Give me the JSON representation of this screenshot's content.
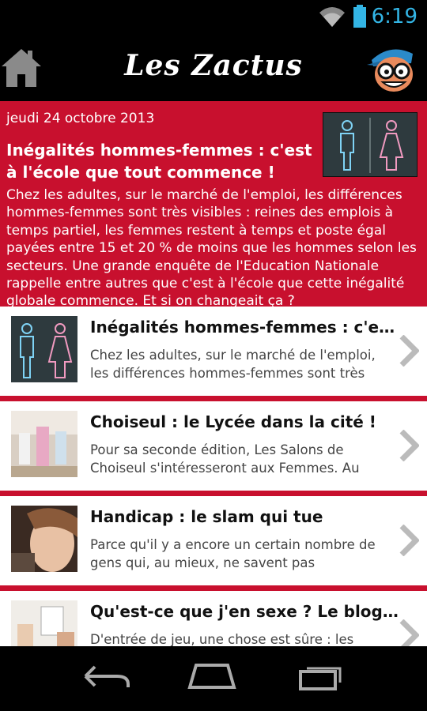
{
  "status": {
    "time": "6:19"
  },
  "app": {
    "title": "Les Zactus"
  },
  "featured": {
    "date": "jeudi 24 octobre 2013",
    "title": "Inégalités hommes-femmes : c'est à l'école que tout commence !",
    "body": "Chez les adultes, sur le marché de l'emploi, les différences hommes-femmes sont très visibles : reines des emplois à temps partiel, les femmes restent à temps et poste égal payées entre 15 et 20 % de moins que les hommes selon les secteurs. Une grande enquête de l'Education Nationale rappelle entre autres que c'est à l'école que cette inégalité globale commence. Et si on changeait ça ?"
  },
  "articles": [
    {
      "title": "Inégalités hommes-femmes : c'est à l'école que tout commence !",
      "desc": "Chez les adultes, sur le marché de l'emploi, les différences hommes-femmes sont très"
    },
    {
      "title": "Choiseul : le Lycée dans la cité !",
      "desc": "Pour sa seconde édition, Les Salons de Choiseul s'intéresseront aux Femmes. Au"
    },
    {
      "title": "Handicap : le slam qui tue",
      "desc": "Parce qu'il y a encore un certain nombre de gens qui, au mieux, ne savent pas"
    },
    {
      "title": "Qu'est-ce que j'en sexe ? Le blog qui répond",
      "desc": "D'entrée de jeu, une chose est sûre : les"
    }
  ]
}
